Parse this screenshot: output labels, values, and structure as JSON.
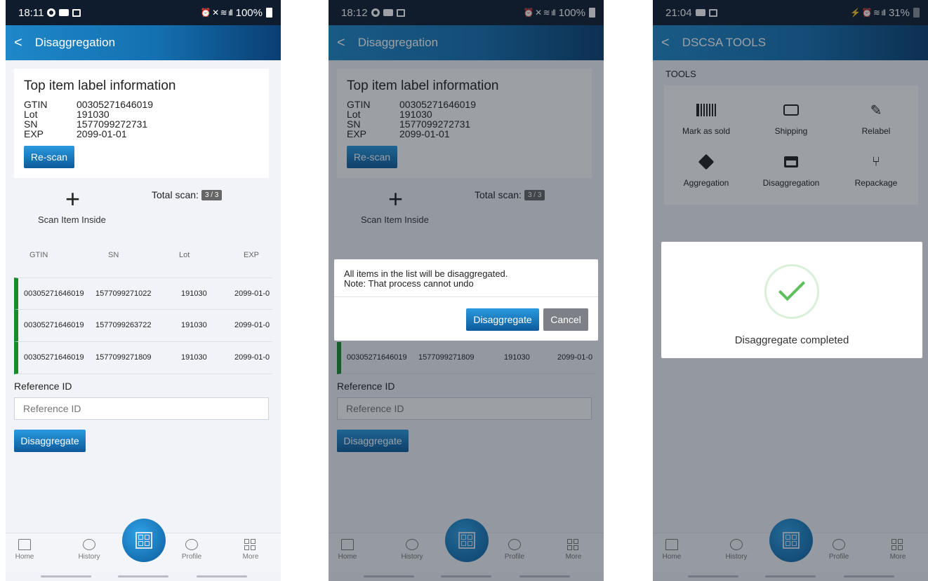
{
  "colors": {
    "appbar": "#1470b0",
    "row_accent": "#1b8a2a",
    "success": "#5dc05d",
    "cancel": "#7d8187"
  },
  "screens": [
    {
      "status": {
        "time": "18:11",
        "battery": "100%"
      },
      "title": "Disaggregation",
      "top_item": {
        "title": "Top item label information",
        "gtin_label": "GTIN",
        "gtin": "00305271646019",
        "lot_label": "Lot",
        "lot": "191030",
        "sn_label": "SN",
        "sn": "1577099272731",
        "exp_label": "EXP",
        "exp": "2099-01-01"
      },
      "rescan_label": "Re-scan",
      "scan_item_label": "Scan Item Inside",
      "total_scan_label": "Total scan:",
      "total_scan_badge": "3 / 3",
      "table": {
        "headers": [
          "GTIN",
          "SN",
          "Lot",
          "EXP"
        ],
        "rows": [
          [
            "00305271646019",
            "1577099271022",
            "191030",
            "2099-01-0"
          ],
          [
            "00305271646019",
            "1577099263722",
            "191030",
            "2099-01-0"
          ],
          [
            "00305271646019",
            "1577099271809",
            "191030",
            "2099-01-0"
          ]
        ]
      },
      "reference": {
        "label": "Reference ID",
        "placeholder": "Reference ID"
      },
      "disaggregate_label": "Disaggregate",
      "nav": [
        "Home",
        "History",
        "Profile",
        "More"
      ]
    },
    {
      "status": {
        "time": "18:12",
        "battery": "100%"
      },
      "title": "Disaggregation",
      "top_item": {
        "title": "Top item label information",
        "gtin_label": "GTIN",
        "gtin": "00305271646019",
        "lot_label": "Lot",
        "lot": "191030",
        "sn_label": "SN",
        "sn": "1577099272731",
        "exp_label": "EXP",
        "exp": "2099-01-01"
      },
      "rescan_label": "Re-scan",
      "scan_item_label": "Scan Item Inside",
      "total_scan_label": "Total scan:",
      "total_scan_badge": "3 / 3",
      "table": {
        "headers": [
          "GTIN",
          "SN",
          "Lot",
          "EXP"
        ],
        "rows": [
          [
            "00305271646019",
            "1577099271809",
            "191030",
            "2099-01-0"
          ]
        ]
      },
      "reference": {
        "label": "Reference ID",
        "placeholder": "Reference ID"
      },
      "disaggregate_label": "Disaggregate",
      "dialog": {
        "line1": "All items in the list will be disaggregated.",
        "line2": "Note: That process cannot undo",
        "confirm": "Disaggregate",
        "cancel": "Cancel"
      },
      "nav": [
        "Home",
        "History",
        "Profile",
        "More"
      ]
    },
    {
      "status": {
        "time": "21:04",
        "battery": "31%"
      },
      "title": "DSCSA TOOLS",
      "tools_label": "TOOLS",
      "tools": [
        {
          "label": "Mark as sold",
          "icon": "barcode-icon"
        },
        {
          "label": "Shipping",
          "icon": "truck-icon"
        },
        {
          "label": "Relabel",
          "icon": "pencil-icon"
        },
        {
          "label": "Aggregation",
          "icon": "box-icon"
        },
        {
          "label": "Disaggregation",
          "icon": "open-box-icon"
        },
        {
          "label": "Repackage",
          "icon": "branch-icon"
        }
      ],
      "success_message": "Disaggregate completed",
      "nav": [
        "Home",
        "History",
        "Profile",
        "More"
      ]
    }
  ]
}
